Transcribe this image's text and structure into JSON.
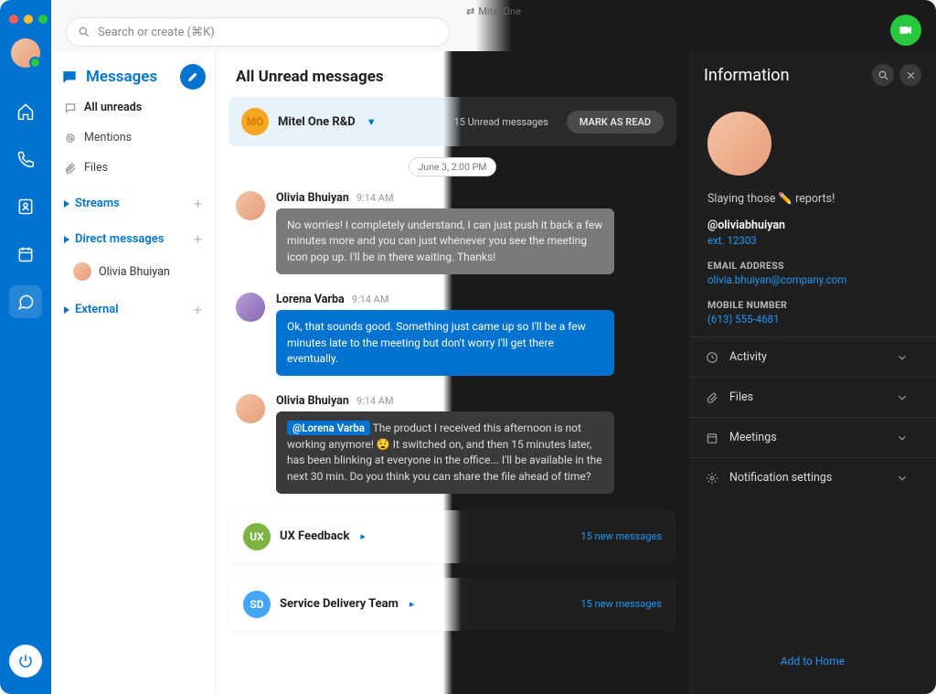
{
  "app": {
    "title": "Mitel One"
  },
  "search": {
    "placeholder": "Search or create (⌘K)"
  },
  "nav": {
    "items": [
      "home",
      "phone",
      "contacts",
      "calendar",
      "messages"
    ]
  },
  "sidebar": {
    "title": "Messages",
    "links": [
      {
        "icon": "chat",
        "label": "All unreads"
      },
      {
        "icon": "at",
        "label": "Mentions"
      },
      {
        "icon": "clip",
        "label": "Files"
      }
    ],
    "sections": {
      "streams": "Streams",
      "direct": "Direct messages",
      "external": "External"
    },
    "dm_contact": "Olivia Bhuiyan"
  },
  "chat": {
    "page_title": "All Unread messages",
    "thread1": {
      "avatar_text": "MO",
      "name": "Mitel One R&D",
      "unread": "15 Unread messages",
      "mark_read": "MARK AS READ",
      "date": "June 3, 2:00 PM"
    },
    "messages": [
      {
        "author": "Olivia Bhuiyan",
        "time": "9:14 AM",
        "bubble_class": "bubble-grey",
        "text": "No worries! I completely understand, I can just push it back a few minutes more and you can just whenever you see the meeting icon pop up. I'll be in there waiting. Thanks!"
      },
      {
        "author": "Lorena Varba",
        "time": "9:14 AM",
        "bubble_class": "bubble-blue",
        "text": "Ok, that sounds good. Something just came up so I'll be a few minutes late to the meeting but don't worry I'll get there eventually."
      },
      {
        "author": "Olivia Bhuiyan",
        "time": "9:14 AM",
        "bubble_class": "bubble-dark",
        "mention": "@Lorena Varba",
        "text": " The product I received this afternoon is not working anymore! 😧 It switched on, and then 15 minutes later, has been blinking at everyone in the office... I'll be available in the next 30 min. Do you think you can share the file ahead of time?"
      }
    ],
    "thread2": {
      "avatar_text": "UX",
      "name": "UX Feedback",
      "meta": "15 new messages"
    },
    "thread3": {
      "avatar_text": "SD",
      "name": "Service Delivery Team",
      "meta": "15 new messages"
    }
  },
  "info": {
    "title": "Information",
    "status": "Slaying those ✏️ reports!",
    "handle": "@oliviabhuiyan",
    "ext": "ext. 12303",
    "email_label": "EMAIL ADDRESS",
    "email": "olivia.bhuiyan@company.com",
    "mobile_label": "MOBILE NUMBER",
    "mobile": "(613) 555-4681",
    "rows": [
      "Activity",
      "Files",
      "Meetings",
      "Notification settings"
    ],
    "footer": "Add to Home"
  }
}
